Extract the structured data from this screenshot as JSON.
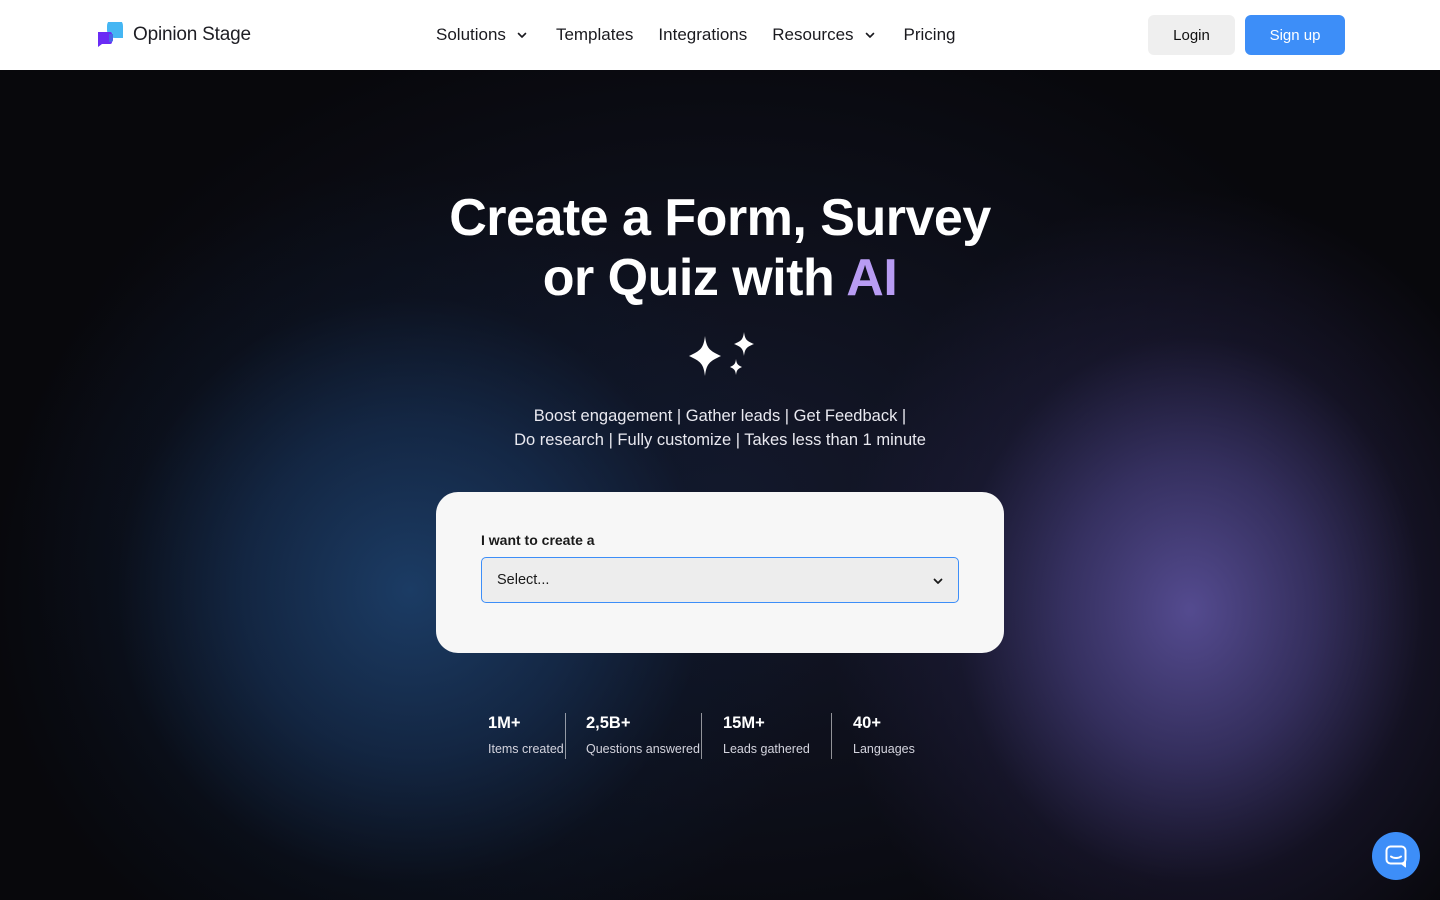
{
  "brand": {
    "name": "Opinion Stage"
  },
  "nav": {
    "items": [
      {
        "label": "Solutions",
        "has_dropdown": true
      },
      {
        "label": "Templates",
        "has_dropdown": false
      },
      {
        "label": "Integrations",
        "has_dropdown": false
      },
      {
        "label": "Resources",
        "has_dropdown": true
      },
      {
        "label": "Pricing",
        "has_dropdown": false
      }
    ],
    "login_label": "Login",
    "signup_label": "Sign up"
  },
  "hero": {
    "title_line1": "Create a Form, Survey",
    "title_line2_prefix": "or Quiz with ",
    "title_line2_highlight": "AI",
    "tagline_line1": "Boost engagement | Gather leads | Get Feedback |",
    "tagline_line2": "Do research | Fully customize | Takes less than 1 minute"
  },
  "create_form": {
    "label": "I want to create a",
    "select_value": "Select..."
  },
  "stats": [
    {
      "value": "1M+",
      "label": "Items created"
    },
    {
      "value": "2,5B+",
      "label": "Questions answered"
    },
    {
      "value": "15M+",
      "label": "Leads gathered"
    },
    {
      "value": "40+",
      "label": "Languages"
    }
  ],
  "icons": {
    "logo": "opinion-stage-logo-icon",
    "dropdown": "chevron-down-icon",
    "sparkles": "sparkles-icon",
    "chat": "chat-icon"
  },
  "colors": {
    "accent": "#3d8ef8",
    "ai_highlight": "#b89cf3",
    "hero_background": "#08080c"
  }
}
